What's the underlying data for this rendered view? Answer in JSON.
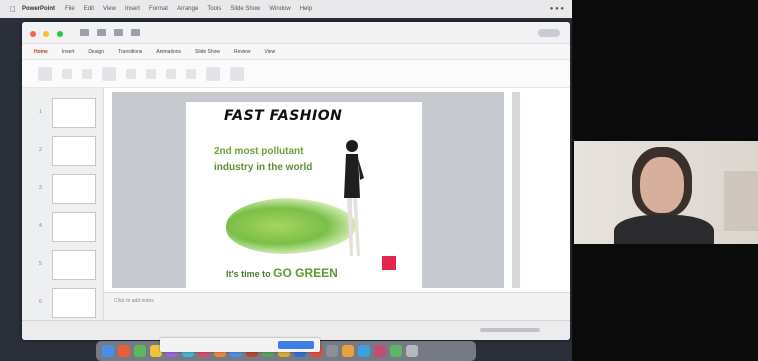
{
  "menubar": {
    "app_name": "PowerPoint",
    "items": [
      "File",
      "Edit",
      "View",
      "Insert",
      "Format",
      "Arrange",
      "Tools",
      "Slide Show",
      "Window",
      "Help"
    ]
  },
  "ribbon": {
    "tabs": [
      "Home",
      "Insert",
      "Design",
      "Transitions",
      "Animations",
      "Slide Show",
      "Review",
      "View"
    ],
    "active_tab": "Home"
  },
  "slide": {
    "title": "FAST FASHION",
    "line1_a": "2nd most pollutant",
    "line2": "industry in the world",
    "bottom_prefix": "It's time to ",
    "bottom_emph": "GO GREEN"
  },
  "notes": {
    "placeholder": "Click to add notes"
  },
  "colors": {
    "accent_green": "#6aa33a",
    "ribbon_active": "#c43e1c",
    "logo_red": "#e2264d",
    "stop_share": "#3d7de6"
  }
}
